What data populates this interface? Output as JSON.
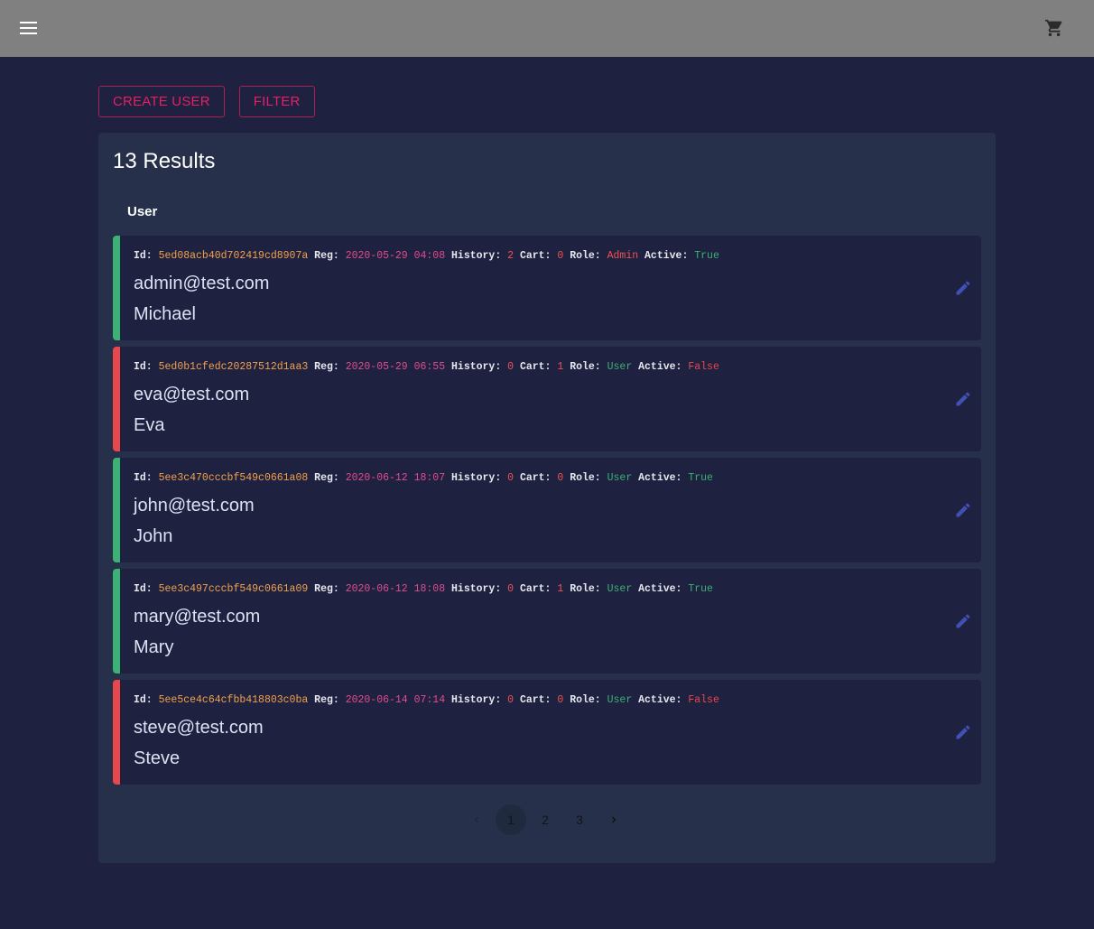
{
  "appbar": {
    "menu_icon": "menu-icon",
    "cart_icon": "shopping-cart-icon"
  },
  "actions": {
    "create_label": "CREATE USER",
    "filter_label": "FILTER"
  },
  "results": {
    "title": "13 Results",
    "column_header": "User"
  },
  "colors": {
    "accent": "#e91e63",
    "active_true": "#3bb273",
    "active_false": "#e8474c",
    "edit_icon": "#3f51b5",
    "id_value": "#f2a14c",
    "reg_value": "#e04d8c",
    "count_value": "#ef5350"
  },
  "labels": {
    "id": "Id:",
    "reg": "Reg:",
    "history": "History:",
    "cart": "Cart:",
    "role": "Role:",
    "active": "Active:"
  },
  "users": [
    {
      "id": "5ed08acb40d702419cd8907a",
      "reg": "2020-05-29 04:08",
      "history": "2",
      "cart": "0",
      "role": "Admin",
      "active": "True",
      "email": "admin@test.com",
      "name": "Michael"
    },
    {
      "id": "5ed0b1cfedc20287512d1aa3",
      "reg": "2020-05-29 06:55",
      "history": "0",
      "cart": "1",
      "role": "User",
      "active": "False",
      "email": "eva@test.com",
      "name": "Eva"
    },
    {
      "id": "5ee3c470cccbf549c0661a08",
      "reg": "2020-06-12 18:07",
      "history": "0",
      "cart": "0",
      "role": "User",
      "active": "True",
      "email": "john@test.com",
      "name": "John"
    },
    {
      "id": "5ee3c497cccbf549c0661a09",
      "reg": "2020-06-12 18:08",
      "history": "0",
      "cart": "1",
      "role": "User",
      "active": "True",
      "email": "mary@test.com",
      "name": "Mary"
    },
    {
      "id": "5ee5ce4c64cfbb418803c0ba",
      "reg": "2020-06-14 07:14",
      "history": "0",
      "cart": "0",
      "role": "User",
      "active": "False",
      "email": "steve@test.com",
      "name": "Steve"
    }
  ],
  "pagination": {
    "pages": [
      "1",
      "2",
      "3"
    ],
    "current": "1"
  }
}
